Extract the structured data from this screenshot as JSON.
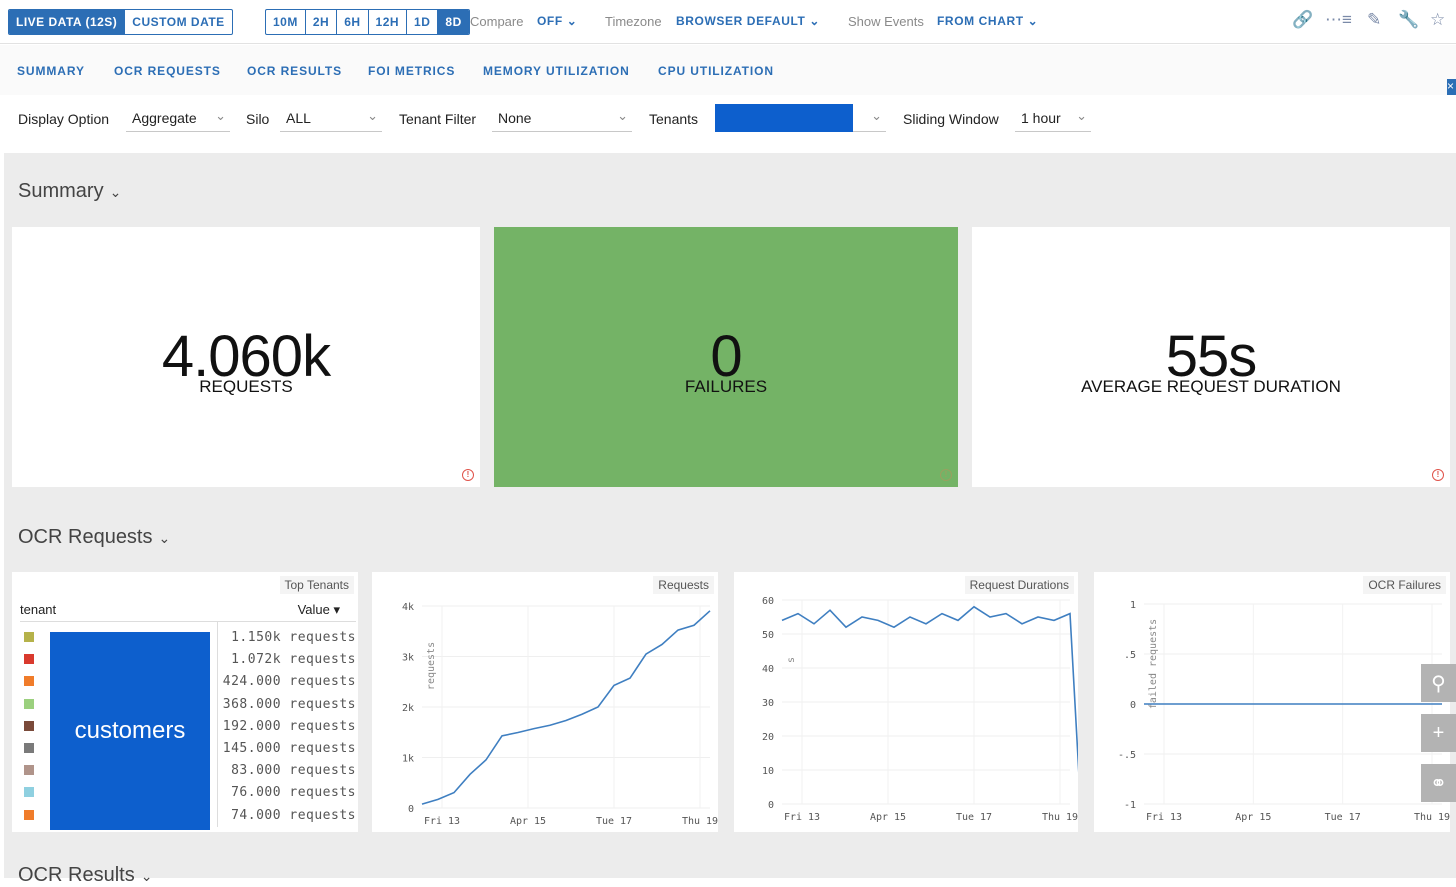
{
  "toolbar": {
    "live_label": "LIVE DATA (12S)",
    "custom_date_label": "CUSTOM DATE",
    "ranges": [
      "10M",
      "2H",
      "6H",
      "12H",
      "1D",
      "8D"
    ],
    "compare_label": "Compare",
    "compare_value": "OFF",
    "timezone_label": "Timezone",
    "timezone_value": "BROWSER DEFAULT",
    "show_events_label": "Show Events",
    "show_events_value": "FROM CHART"
  },
  "tabs": [
    "SUMMARY",
    "OCR REQUESTS",
    "OCR RESULTS",
    "FOI METRICS",
    "MEMORY UTILIZATION",
    "CPU UTILIZATION"
  ],
  "filters": {
    "display_label": "Display Option",
    "display_value": "Aggregate",
    "silo_label": "Silo",
    "silo_value": "ALL",
    "tenant_filter_label": "Tenant Filter",
    "tenant_filter_value": "None",
    "tenants_label": "Tenants",
    "sliding_label": "Sliding Window",
    "sliding_value": "1 hour"
  },
  "summary": {
    "title": "Summary",
    "requests_value": "4.060k",
    "requests_caption": "REQUESTS",
    "failures_value": "0",
    "failures_caption": "FAILURES",
    "duration_value": "55s",
    "duration_caption": "AVERAGE REQUEST DURATION"
  },
  "ocr_requests": {
    "title": "OCR Requests",
    "top_tenants": {
      "title": "Top Tenants",
      "col_tenant": "tenant",
      "col_value": "Value ▾",
      "tooltip": "customers",
      "rows": [
        {
          "value": "1.150k requests",
          "color": "#b5b24a"
        },
        {
          "value": "1.072k requests",
          "color": "#d93a2e"
        },
        {
          "value": "424.000 requests",
          "color": "#f07c2a"
        },
        {
          "value": "368.000 requests",
          "color": "#9bd07e"
        },
        {
          "value": "192.000 requests",
          "color": "#7a4a3a"
        },
        {
          "value": "145.000 requests",
          "color": "#7a7a7a"
        },
        {
          "value": "83.000 requests",
          "color": "#b0948a"
        },
        {
          "value": "76.000 requests",
          "color": "#8fd0e0"
        },
        {
          "value": "74.000 requests",
          "color": "#f07c2a"
        }
      ]
    }
  },
  "next_section_title": "OCR Results",
  "chart_data": [
    {
      "type": "line",
      "title": "Requests",
      "ylabel": "requests",
      "xticks": [
        "Fri 13",
        "Apr 15",
        "Tue 17",
        "Thu 19"
      ],
      "yticks": [
        "0",
        "1k",
        "2k",
        "3k",
        "4k"
      ],
      "ylim": [
        0,
        4200
      ],
      "x": [
        0,
        0.5,
        1,
        1.5,
        2,
        2.5,
        3,
        3.5,
        4,
        4.5,
        5,
        5.5,
        6,
        6.5,
        7,
        7.5,
        8,
        8.5,
        9
      ],
      "series": [
        {
          "values": [
            80,
            180,
            320,
            700,
            1000,
            1500,
            1570,
            1650,
            1720,
            1820,
            1950,
            2100,
            2550,
            2700,
            3200,
            3400,
            3700,
            3800,
            4100
          ]
        }
      ]
    },
    {
      "type": "line",
      "title": "Request Durations",
      "ylabel": "s",
      "xticks": [
        "Fri 13",
        "Apr 15",
        "Tue 17",
        "Thu 19"
      ],
      "yticks": [
        "0",
        "10",
        "20",
        "30",
        "40",
        "50",
        "60"
      ],
      "ylim": [
        0,
        60
      ],
      "x": [
        0,
        0.5,
        1,
        1.5,
        2,
        2.5,
        3,
        3.5,
        4,
        4.5,
        5,
        5.5,
        6,
        6.5,
        7,
        7.5,
        8,
        8.5,
        9,
        9.3
      ],
      "series": [
        {
          "values": [
            54,
            56,
            53,
            57,
            52,
            55,
            54,
            52,
            55,
            53,
            56,
            54,
            58,
            55,
            56,
            53,
            55,
            54,
            56,
            5
          ]
        }
      ]
    },
    {
      "type": "line",
      "title": "OCR Failures",
      "ylabel": "failed requests",
      "xticks": [
        "Fri 13",
        "Apr 15",
        "Tue 17",
        "Thu 19"
      ],
      "yticks": [
        "-1",
        "-.5",
        "0",
        ".5",
        "1"
      ],
      "ylim": [
        -1,
        1
      ],
      "x": [
        0,
        9
      ],
      "series": [
        {
          "values": [
            0,
            0
          ]
        }
      ]
    }
  ]
}
